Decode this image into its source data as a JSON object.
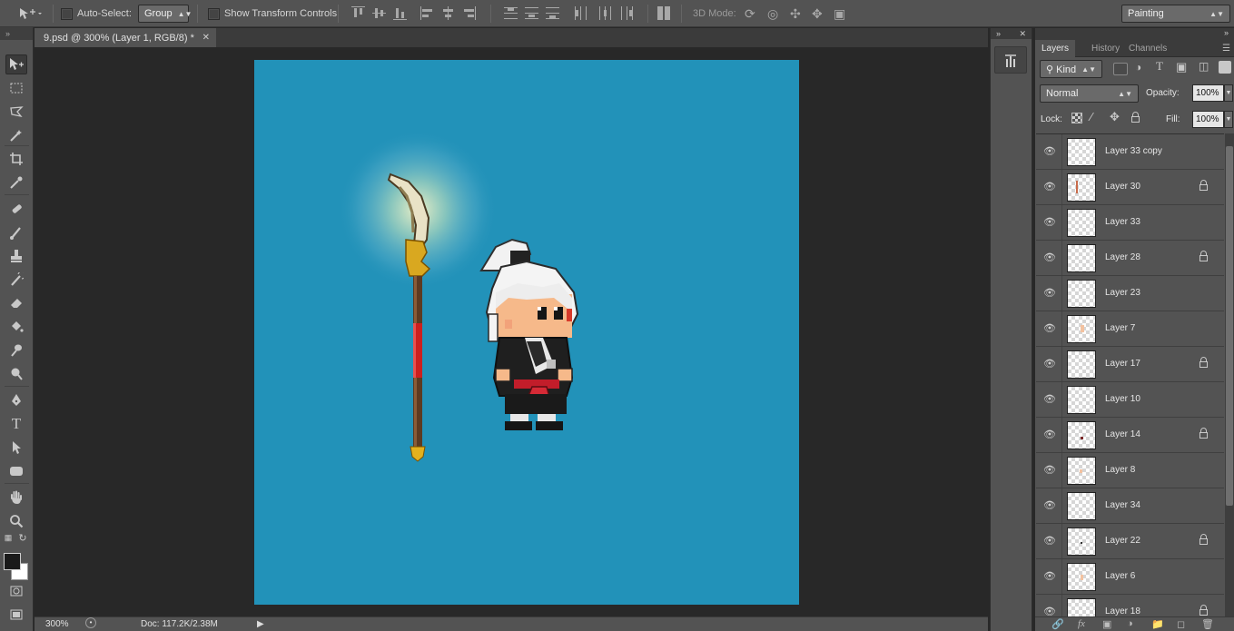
{
  "options_bar": {
    "auto_select_label": "Auto-Select:",
    "auto_select_value": "Group",
    "show_transform_label": "Show Transform Controls",
    "mode_3d_label": "3D Mode:",
    "workspace_value": "Painting"
  },
  "document": {
    "tab_title": "9.psd @ 300% (Layer 1, RGB/8) *",
    "zoom": "300%",
    "doc_info": "Doc: 117.2K/2.38M",
    "canvas_color": "#2292b9"
  },
  "panel": {
    "tabs": [
      "Layers",
      "History",
      "Channels"
    ],
    "kind_label": "Kind",
    "blend_mode": "Normal",
    "opacity_label": "Opacity:",
    "opacity_value": "100%",
    "lock_label": "Lock:",
    "fill_label": "Fill:",
    "fill_value": "100%",
    "layers": [
      {
        "name": "Layer 33 copy",
        "locked": false
      },
      {
        "name": "Layer 30",
        "locked": true
      },
      {
        "name": "Layer 33",
        "locked": false
      },
      {
        "name": "Layer 28",
        "locked": true
      },
      {
        "name": "Layer 23",
        "locked": false
      },
      {
        "name": "Layer 7",
        "locked": false
      },
      {
        "name": "Layer 17",
        "locked": true
      },
      {
        "name": "Layer 10",
        "locked": false
      },
      {
        "name": "Layer 14",
        "locked": true
      },
      {
        "name": "Layer 8",
        "locked": false
      },
      {
        "name": "Layer 34",
        "locked": false
      },
      {
        "name": "Layer 22",
        "locked": true
      },
      {
        "name": "Layer 6",
        "locked": false
      },
      {
        "name": "Layer 18",
        "locked": true
      }
    ]
  }
}
